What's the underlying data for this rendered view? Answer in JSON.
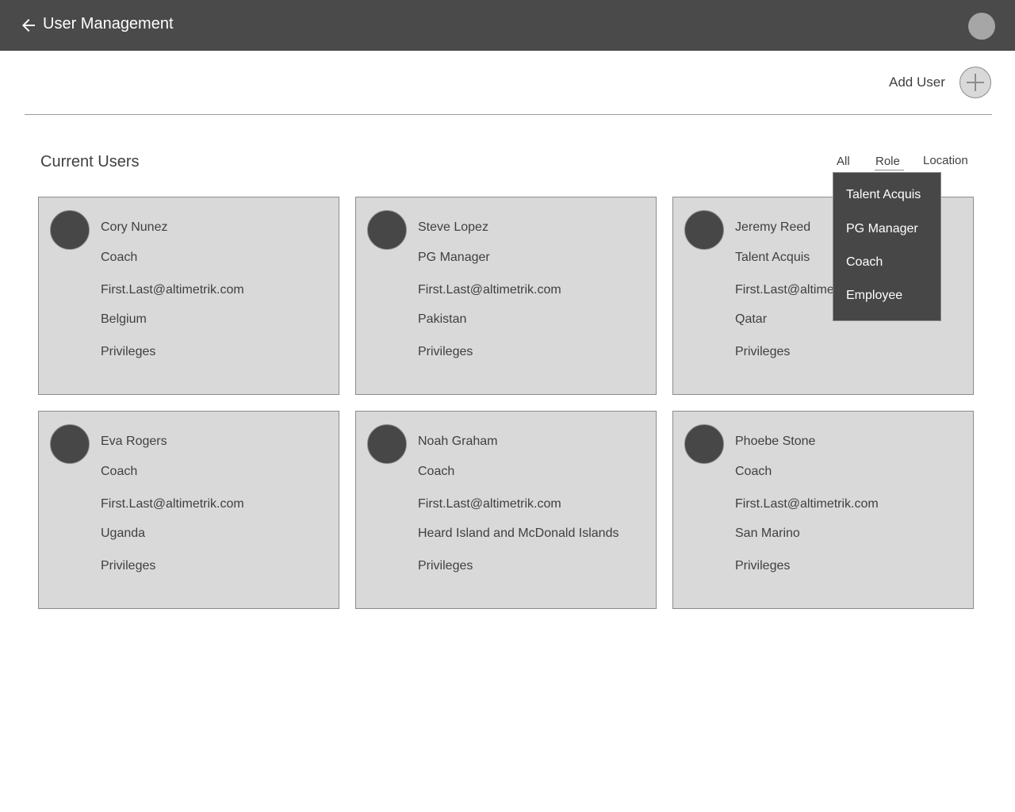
{
  "header": {
    "title": "User Management",
    "back_icon": "arrow-left-icon",
    "bar_color": "#4a4a4a"
  },
  "toolbar": {
    "add_user_label": "Add User",
    "add_icon": "plus-icon"
  },
  "section": {
    "title": "Current Users"
  },
  "filters": {
    "tabs": [
      {
        "label": "All"
      },
      {
        "label": "Role",
        "active": true
      },
      {
        "label": "Location"
      }
    ]
  },
  "role_dropdown": {
    "items": [
      {
        "label": "Talent Acquis"
      },
      {
        "label": "PG Manager"
      },
      {
        "label": "Coach"
      },
      {
        "label": "Employee"
      }
    ]
  },
  "users": [
    {
      "name": "Cory Nunez",
      "role": "Coach",
      "email": "First.Last@altimetrik.com",
      "country": "Belgium",
      "privileges": "Privileges"
    },
    {
      "name": "Steve Lopez",
      "role": "PG Manager",
      "email": "First.Last@altimetrik.com",
      "country": "Pakistan",
      "privileges": "Privileges"
    },
    {
      "name": "Jeremy Reed",
      "role": "Talent Acquis",
      "email": "First.Last@altimetrik.com",
      "country": "Qatar",
      "privileges": "Privileges"
    },
    {
      "name": "Eva Rogers",
      "role": "Coach",
      "email": "First.Last@altimetrik.com",
      "country": "Uganda",
      "privileges": "Privileges"
    },
    {
      "name": "Noah Graham",
      "role": "Coach",
      "email": "First.Last@altimetrik.com",
      "country": "Heard Island and McDonald Islands",
      "privileges": "Privileges"
    },
    {
      "name": "Phoebe Stone",
      "role": "Coach",
      "email": "First.Last@altimetrik.com",
      "country": "San Marino",
      "privileges": "Privileges"
    }
  ]
}
